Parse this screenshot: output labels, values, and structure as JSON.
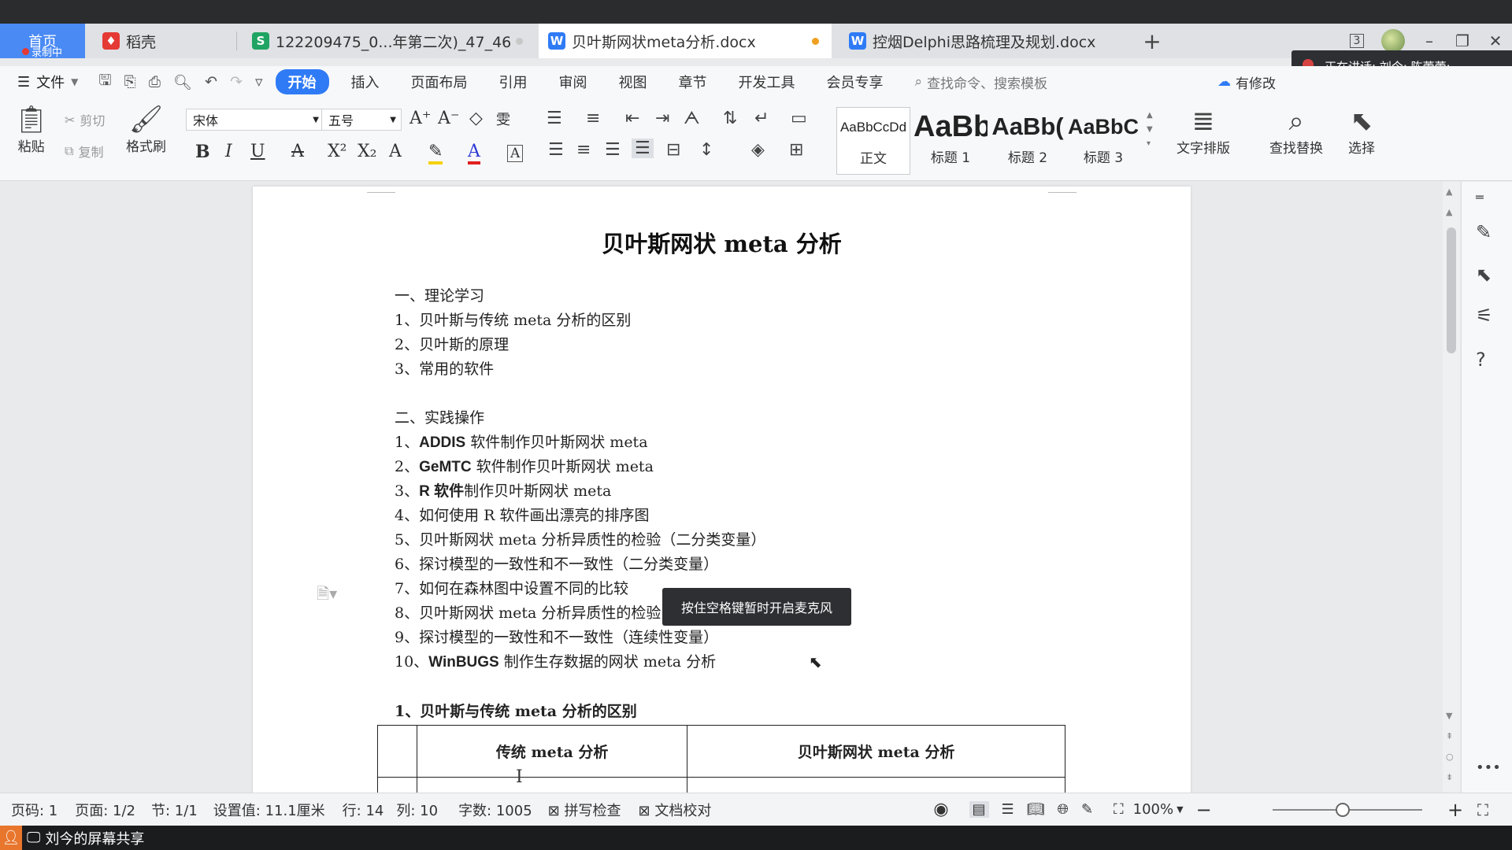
{
  "tabs": {
    "home": {
      "label": "首页",
      "rec": "录制中"
    },
    "daoke": {
      "label": "稻壳"
    },
    "sheet": {
      "label": "122209475_0...年第二次)_47_46"
    },
    "doc1": {
      "label": "贝叶斯网状meta分析.docx"
    },
    "doc2": {
      "label": "控烟Delphi思路梳理及规划.docx"
    },
    "window_badge": "3",
    "speaking": "正在讲话: 刘今; 陈蕾蕾;"
  },
  "menu": {
    "file": "文件",
    "items": [
      "开始",
      "插入",
      "页面布局",
      "引用",
      "审阅",
      "视图",
      "章节",
      "开发工具",
      "会员专享"
    ],
    "search": "查找命令、搜索模板",
    "right": "有修改"
  },
  "ribbon": {
    "paste": "粘贴",
    "cut": "剪切",
    "copy": "复制",
    "format_painter": "格式刷",
    "font_name": "宋体",
    "font_size": "五号",
    "styles": [
      {
        "sample": "AaBbCcDd",
        "label": "正文"
      },
      {
        "sample": "AaBb",
        "label": "标题 1"
      },
      {
        "sample": "AaBb(",
        "label": "标题 2"
      },
      {
        "sample": "AaBbC",
        "label": "标题 3"
      }
    ],
    "text_layout": "文字排版",
    "find_replace": "查找替换",
    "select": "选择"
  },
  "document": {
    "title": "贝叶斯网状 meta 分析",
    "lines": [
      {
        "prefix": "一、理论学习",
        "bold": "",
        "rest": ""
      },
      {
        "prefix": "1、贝叶斯与传统 meta 分析的区别",
        "bold": "",
        "rest": ""
      },
      {
        "prefix": "2、贝叶斯的原理",
        "bold": "",
        "rest": ""
      },
      {
        "prefix": "3、常用的软件",
        "bold": "",
        "rest": ""
      },
      {
        "prefix": "二、实践操作",
        "bold": "",
        "rest": ""
      },
      {
        "prefix": "1、",
        "bold": "ADDIS",
        "rest": " 软件制作贝叶斯网状 meta"
      },
      {
        "prefix": "2、",
        "bold": "GeMTC",
        "rest": " 软件制作贝叶斯网状 meta"
      },
      {
        "prefix": "3、",
        "bold": "R 软件",
        "rest": "制作贝叶斯网状 meta"
      },
      {
        "prefix": "4、如何使用 R 软件画出漂亮的排序图",
        "bold": "",
        "rest": ""
      },
      {
        "prefix": "5、贝叶斯网状 meta 分析异质性的检验（二分类变量）",
        "bold": "",
        "rest": ""
      },
      {
        "prefix": "6、探讨模型的一致性和不一致性（二分类变量）",
        "bold": "",
        "rest": ""
      },
      {
        "prefix": "7、如何在森林图中设置不同的比较",
        "bold": "",
        "rest": ""
      },
      {
        "prefix": "8、贝叶斯网状 meta 分析异质性的检验（连续性变量）",
        "bold": "",
        "rest": ""
      },
      {
        "prefix": "9、探讨模型的一致性和不一致性（连续性变量）",
        "bold": "",
        "rest": ""
      },
      {
        "prefix": "10、",
        "bold": "WinBUGS",
        "rest": " 制作生存数据的网状 meta 分析"
      }
    ],
    "section_heading": "1、贝叶斯与传统 meta 分析的区别",
    "table_headers": [
      "",
      "传统 meta 分析",
      "贝叶斯网状 meta 分析"
    ],
    "tooltip": "按住空格键暂时开启麦克风"
  },
  "status": {
    "page_no": "页码: 1",
    "pages": "页面: 1/2",
    "section": "节: 1/1",
    "setting": "设置值: 11.1厘米",
    "row": "行: 14",
    "col": "列: 10",
    "words": "字数: 1005",
    "spell": "拼写检查",
    "proof": "文档校对",
    "zoom": "100%",
    "zoom_fraction": 0.47
  },
  "share": {
    "label": "刘今的屏幕共享"
  },
  "colors": {
    "accent": "#2f7bf6",
    "home_tab": "#4a8af4",
    "wps_red": "#e53935",
    "sheet_green": "#1fa463",
    "doc_blue": "#2f7bf6",
    "unsaved_dot": "#f0a020"
  }
}
